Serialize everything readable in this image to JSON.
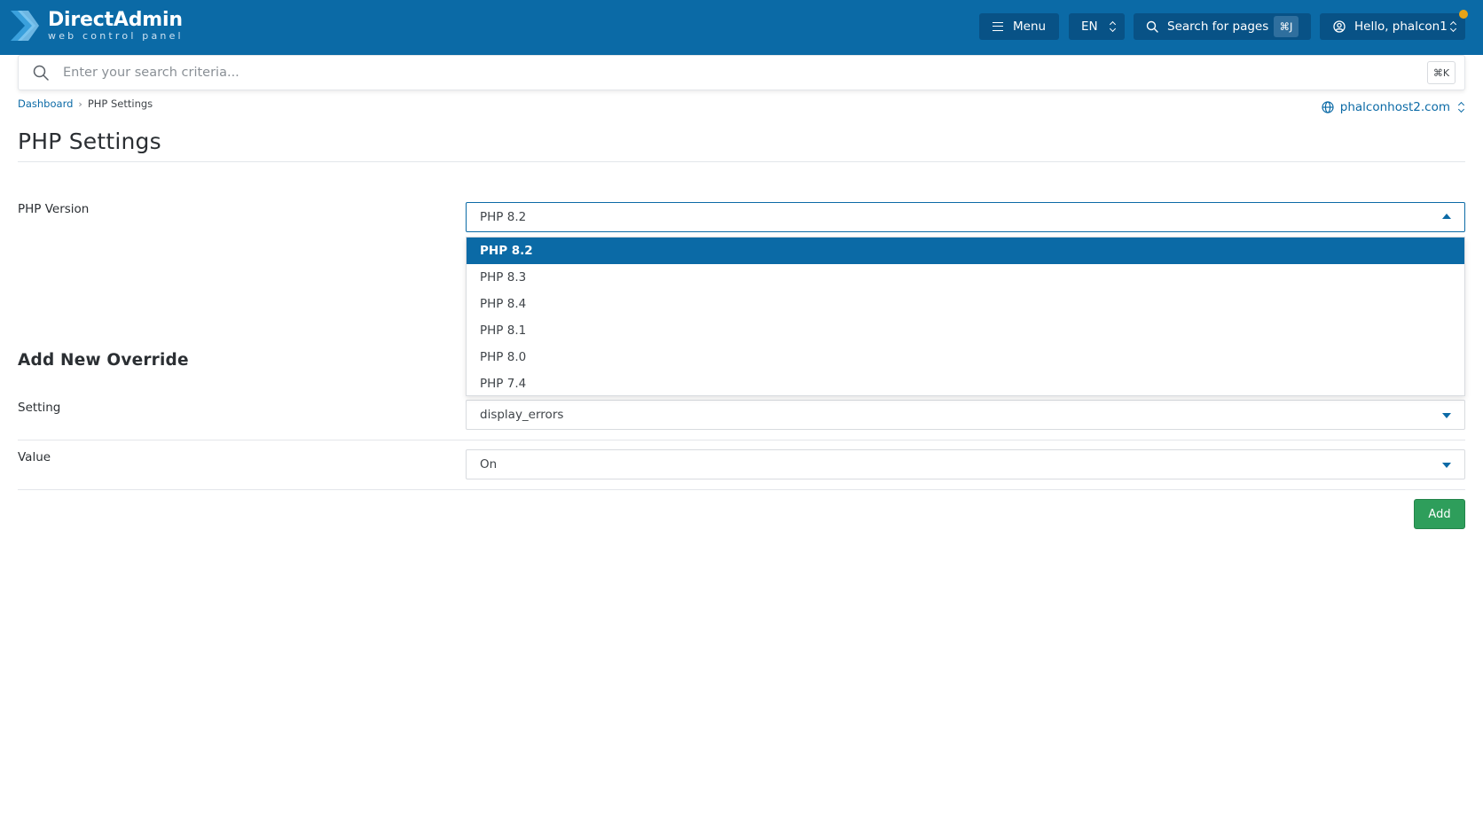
{
  "brand": {
    "name": "DirectAdmin",
    "tagline": "web control panel"
  },
  "topbar": {
    "menu_label": "Menu",
    "language": "EN",
    "search_label": "Search for pages",
    "search_shortcut": "⌘J",
    "user_greeting": "Hello, phalcon1",
    "notification_color": "#e8a317"
  },
  "global_search": {
    "placeholder": "Enter your search criteria...",
    "shortcut": "⌘K"
  },
  "breadcrumb": {
    "home": "Dashboard",
    "separator": "›",
    "current": "PHP Settings"
  },
  "domain_selector": {
    "value": "phalconhost2.com"
  },
  "page": {
    "title": "PHP Settings"
  },
  "php_version": {
    "label": "PHP Version",
    "selected": "PHP 8.2",
    "options": [
      "PHP 8.2",
      "PHP 8.3",
      "PHP 8.4",
      "PHP 8.1",
      "PHP 8.0",
      "PHP 7.4"
    ]
  },
  "override": {
    "title": "Add New Override",
    "setting_label": "Setting",
    "setting_value": "display_errors",
    "value_label": "Value",
    "value_value": "On",
    "add_button": "Add"
  },
  "colors": {
    "brand_blue": "#0b6aa6",
    "add_green": "#2e9e5b"
  },
  "icons": [
    "directadmin-logo-icon",
    "hamburger-icon",
    "search-icon",
    "user-circle-icon",
    "globe-icon",
    "chevron-updown-icon",
    "caret-down-icon",
    "caret-up-icon"
  ]
}
